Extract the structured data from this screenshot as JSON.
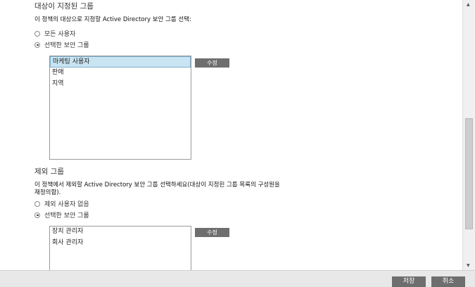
{
  "targeted": {
    "title": "대상이 지정된 그룹",
    "description": "이 정책의 대상으로 지정할 Active Directory 보안 그룹 선택:",
    "options": [
      "모든 사용자",
      "선택한 보안 그룹"
    ],
    "selected_option": "선택한 보안 그룹",
    "groups": [
      "마케팅 사용자",
      "판매",
      "지역"
    ],
    "selected_group": "마케팅 사용자",
    "edit_label": "수정"
  },
  "excluded": {
    "title": "제외 그룹",
    "description_line1": "이 정책에서 제외할 Active Directory 보안 그룹 선택하세요(대상이 지정된 그룹 목록의 구성원을",
    "description_line2": "재정의함).",
    "options": [
      "제외 사용자 없음",
      "선택한 보안 그룹"
    ],
    "selected_option": "선택한 보안 그룹",
    "groups": [
      "장치 관리자",
      "회사 관리자"
    ],
    "edit_label": "수정"
  },
  "footer": {
    "save_label": "저장",
    "cancel_label": "취소"
  }
}
